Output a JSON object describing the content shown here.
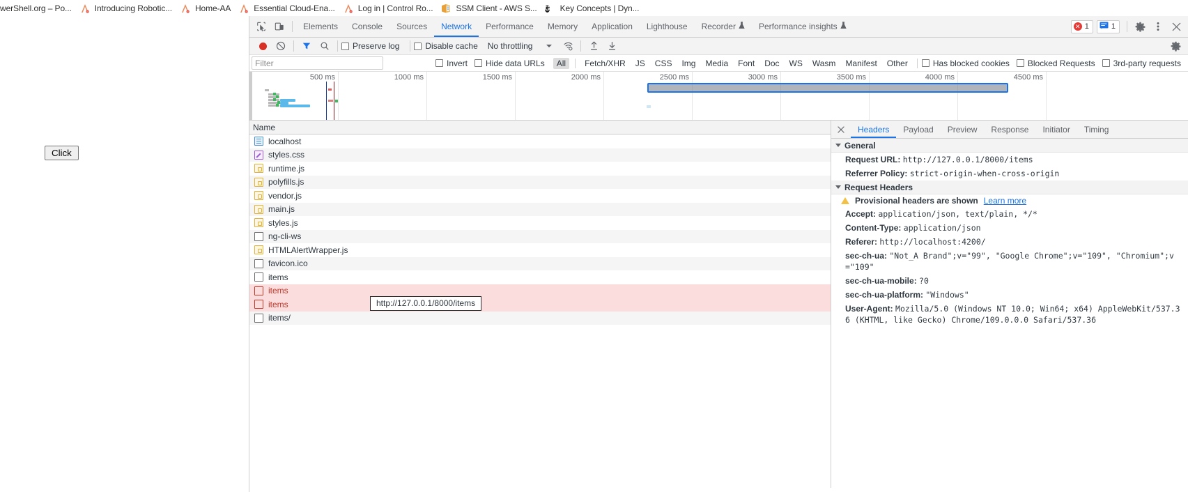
{
  "bookmarks": [
    {
      "label": "werShell.org – Po...",
      "icon": "page-icon",
      "truncated_left": true
    },
    {
      "label": "Introducing Robotic...",
      "icon": "acrobat-icon"
    },
    {
      "label": "Home-AA",
      "icon": "acrobat-icon"
    },
    {
      "label": "Essential Cloud-Ena...",
      "icon": "acrobat-icon"
    },
    {
      "label": "Log in | Control Ro...",
      "icon": "acrobat-icon"
    },
    {
      "label": "SSM Client - AWS S...",
      "icon": "box-icon"
    },
    {
      "label": "Key Concepts | Dyn...",
      "icon": "grammarly-icon"
    }
  ],
  "page": {
    "click_button_label": "Click"
  },
  "devtools": {
    "toolbar_icons": {
      "inspect": "inspect-element-icon",
      "device": "device-toolbar-icon"
    },
    "tabs": [
      {
        "label": "Elements",
        "active": false,
        "flask": false
      },
      {
        "label": "Console",
        "active": false,
        "flask": false
      },
      {
        "label": "Sources",
        "active": false,
        "flask": false
      },
      {
        "label": "Network",
        "active": true,
        "flask": false
      },
      {
        "label": "Performance",
        "active": false,
        "flask": false
      },
      {
        "label": "Memory",
        "active": false,
        "flask": false
      },
      {
        "label": "Application",
        "active": false,
        "flask": false
      },
      {
        "label": "Lighthouse",
        "active": false,
        "flask": false
      },
      {
        "label": "Recorder",
        "active": false,
        "flask": true
      },
      {
        "label": "Performance insights",
        "active": false,
        "flask": true
      }
    ],
    "status_counters": {
      "errors": "1",
      "messages": "1"
    },
    "right_icons": {
      "settings": "gear-icon",
      "more": "kebab-menu-icon",
      "close": "close-icon"
    },
    "action_bar": {
      "record_tooltip": "record-button",
      "clear_tooltip": "clear-icon",
      "filter_tooltip": "filter-funnel-icon",
      "search_tooltip": "search-icon",
      "preserve_log_label": "Preserve log",
      "preserve_log_checked": false,
      "disable_cache_label": "Disable cache",
      "disable_cache_checked": false,
      "throttling_value": "No throttling",
      "wifi_icon": "network-conditions-icon",
      "import_icon": "import-har-icon",
      "export_icon": "export-har-icon",
      "settings_icon": "gear-icon"
    },
    "filter_bar": {
      "filter_placeholder": "Filter",
      "filter_value": "",
      "invert_label": "Invert",
      "invert_checked": false,
      "hide_data_urls_label": "Hide data URLs",
      "hide_data_urls_checked": false,
      "types": [
        "All",
        "Fetch/XHR",
        "JS",
        "CSS",
        "Img",
        "Media",
        "Font",
        "Doc",
        "WS",
        "Wasm",
        "Manifest",
        "Other"
      ],
      "active_type": "All",
      "has_blocked_cookies_label": "Has blocked cookies",
      "has_blocked_cookies_checked": false,
      "blocked_requests_label": "Blocked Requests",
      "blocked_requests_checked": false,
      "third_party_label": "3rd-party requests",
      "third_party_checked": false
    },
    "overview": {
      "ticks": [
        "500 ms",
        "1000 ms",
        "1500 ms",
        "2000 ms",
        "2500 ms",
        "3000 ms",
        "3500 ms",
        "4000 ms",
        "4500 ms"
      ],
      "selection_start_ms": 2470,
      "selection_end_ms": 4450
    },
    "request_list": {
      "column_header": "Name",
      "rows": [
        {
          "name": "localhost",
          "icon": "document-icon",
          "error": false
        },
        {
          "name": "styles.css",
          "icon": "stylesheet-icon",
          "error": false
        },
        {
          "name": "runtime.js",
          "icon": "script-icon",
          "error": false
        },
        {
          "name": "polyfills.js",
          "icon": "script-icon",
          "error": false
        },
        {
          "name": "vendor.js",
          "icon": "script-icon",
          "error": false
        },
        {
          "name": "main.js",
          "icon": "script-icon",
          "error": false
        },
        {
          "name": "styles.js",
          "icon": "script-icon",
          "error": false
        },
        {
          "name": "ng-cli-ws",
          "icon": "generic-file-icon",
          "error": false
        },
        {
          "name": "HTMLAlertWrapper.js",
          "icon": "script-icon",
          "error": false
        },
        {
          "name": "favicon.ico",
          "icon": "generic-file-icon",
          "error": false
        },
        {
          "name": "items",
          "icon": "generic-file-icon",
          "error": false
        },
        {
          "name": "items",
          "icon": "generic-file-icon",
          "error": true
        },
        {
          "name": "items",
          "icon": "generic-file-icon",
          "error": true
        },
        {
          "name": "items/",
          "icon": "generic-file-icon",
          "error": false
        }
      ],
      "tooltip": "http://127.0.0.1/8000/items"
    },
    "details": {
      "close_icon": "close-icon",
      "tabs": [
        {
          "label": "Headers",
          "active": true
        },
        {
          "label": "Payload",
          "active": false
        },
        {
          "label": "Preview",
          "active": false
        },
        {
          "label": "Response",
          "active": false
        },
        {
          "label": "Initiator",
          "active": false
        },
        {
          "label": "Timing",
          "active": false
        }
      ],
      "sections": [
        {
          "title": "General",
          "rows": [
            {
              "name": "Request URL:",
              "value": "http://127.0.0.1/8000/items"
            },
            {
              "name": "Referrer Policy:",
              "value": "strict-origin-when-cross-origin"
            }
          ]
        },
        {
          "title": "Request Headers",
          "warning": "Provisional headers are shown",
          "warning_link": "Learn more",
          "rows": [
            {
              "name": "Accept:",
              "value": "application/json, text/plain, */*"
            },
            {
              "name": "Content-Type:",
              "value": "application/json"
            },
            {
              "name": "Referer:",
              "value": "http://localhost:4200/"
            },
            {
              "name": "sec-ch-ua:",
              "value": "\"Not_A Brand\";v=\"99\", \"Google Chrome\";v=\"109\", \"Chromium\";v=\"109\""
            },
            {
              "name": "sec-ch-ua-mobile:",
              "value": "?0"
            },
            {
              "name": "sec-ch-ua-platform:",
              "value": "\"Windows\""
            },
            {
              "name": "User-Agent:",
              "value": "Mozilla/5.0 (Windows NT 10.0; Win64; x64) AppleWebKit/537.36 (KHTML, like Gecko) Chrome/109.0.0.0 Safari/537.36"
            }
          ]
        }
      ]
    }
  },
  "colors": {
    "accent": "#1a73e8",
    "error": "#c0392b",
    "record": "#d93025",
    "error_row_bg": "#fbdddd",
    "toolbar_bg": "#f3f3f3"
  }
}
